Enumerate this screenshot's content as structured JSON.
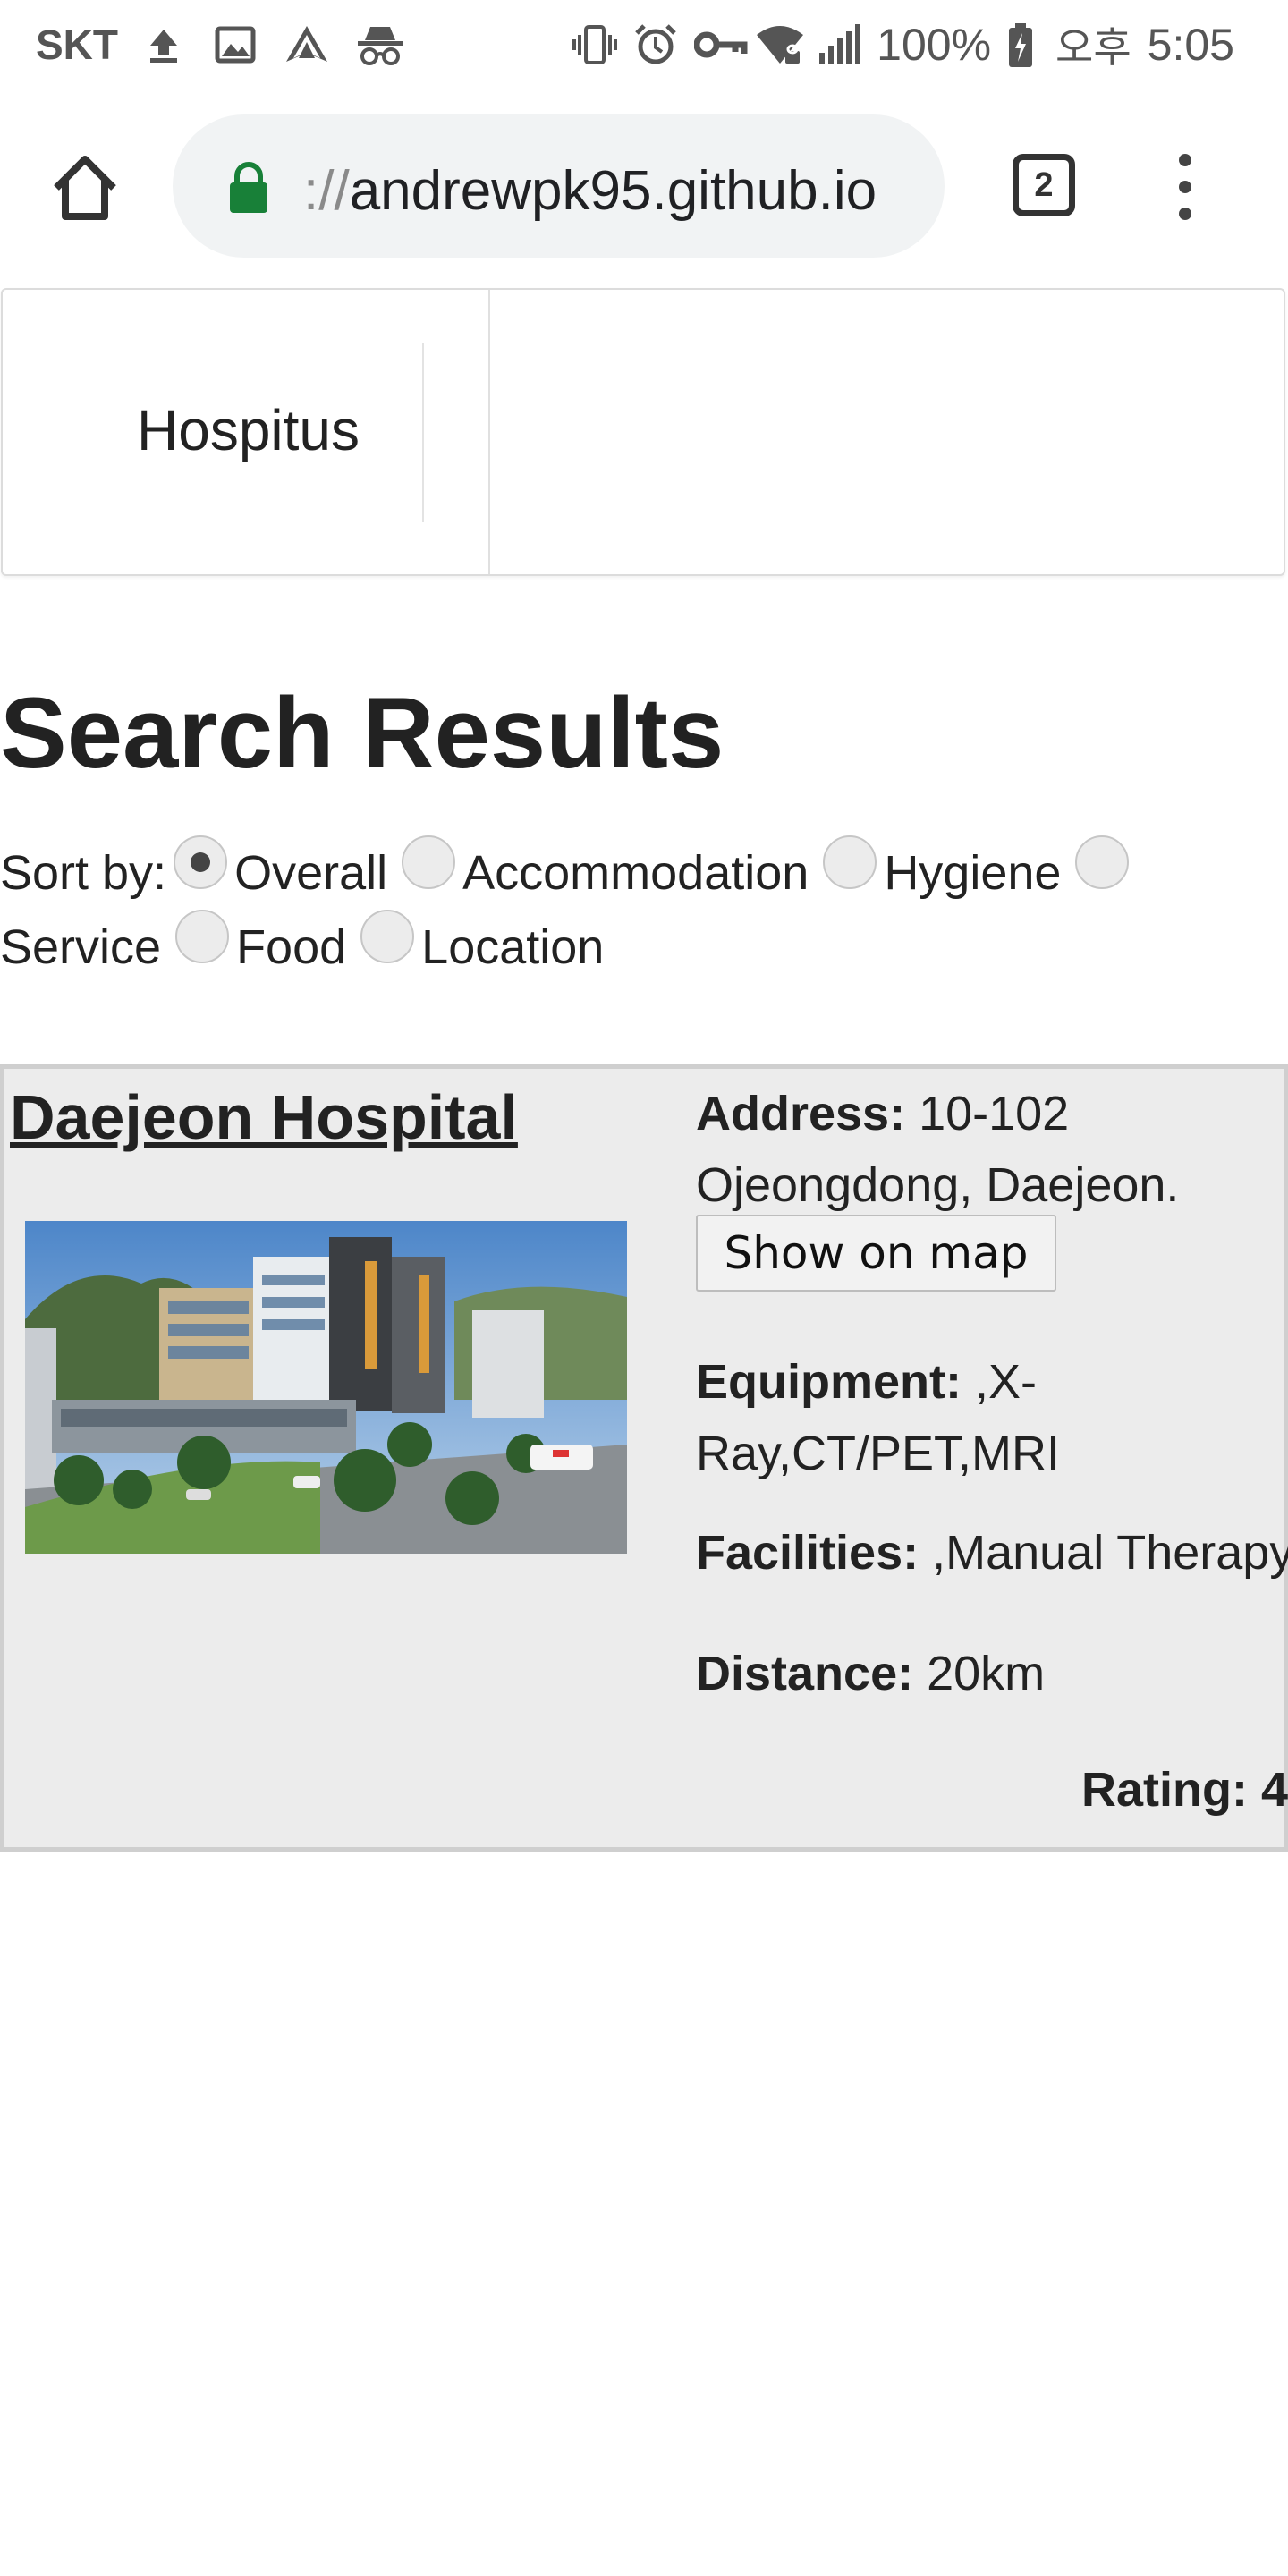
{
  "status_bar": {
    "carrier": "SKT",
    "battery": "100%",
    "time_period": "오후",
    "time": "5:05"
  },
  "browser": {
    "url_scheme": "://",
    "url_host": "andrewpk95.github.io",
    "tab_count": "2"
  },
  "nav": {
    "brand": "Hospitus"
  },
  "page": {
    "title": "Search Results",
    "sort_label": "Sort by:",
    "sort_options": [
      "Overall",
      "Accommodation",
      "Hygiene",
      "Service",
      "Food",
      "Location"
    ],
    "sort_selected": "Overall"
  },
  "result": {
    "name": "Daejeon Hospital",
    "address_label": "Address:",
    "address_value": " 10-102 Ojeongdong, Daejeon.",
    "map_button": "Show on map",
    "equipment_label": "Equipment:",
    "equipment_value": " ,X-Ray,CT/PET,MRI",
    "facilities_label": "Facilities:",
    "facilities_value": " ,Manual Therapy",
    "distance_label": "Distance:",
    "distance_value": " 20km",
    "rating_label": "Rating:",
    "rating_value": " 4"
  },
  "colors": {
    "lock_green": "#188038",
    "card_bg": "#ececec"
  }
}
